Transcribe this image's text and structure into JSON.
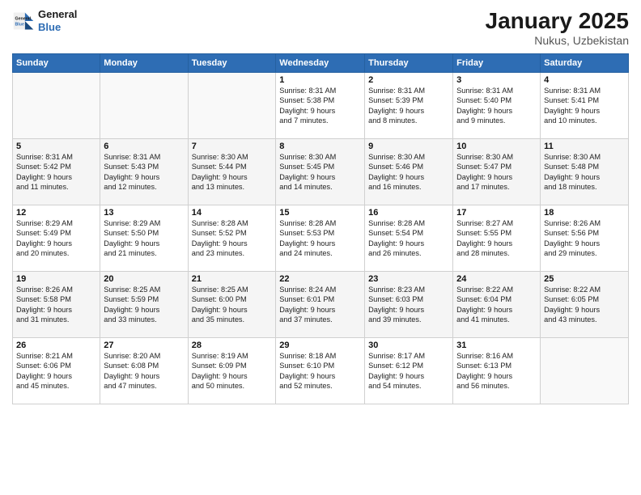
{
  "logo": {
    "line1": "General",
    "line2": "Blue"
  },
  "title": "January 2025",
  "subtitle": "Nukus, Uzbekistan",
  "weekdays": [
    "Sunday",
    "Monday",
    "Tuesday",
    "Wednesday",
    "Thursday",
    "Friday",
    "Saturday"
  ],
  "weeks": [
    [
      {
        "day": "",
        "info": ""
      },
      {
        "day": "",
        "info": ""
      },
      {
        "day": "",
        "info": ""
      },
      {
        "day": "1",
        "info": "Sunrise: 8:31 AM\nSunset: 5:38 PM\nDaylight: 9 hours\nand 7 minutes."
      },
      {
        "day": "2",
        "info": "Sunrise: 8:31 AM\nSunset: 5:39 PM\nDaylight: 9 hours\nand 8 minutes."
      },
      {
        "day": "3",
        "info": "Sunrise: 8:31 AM\nSunset: 5:40 PM\nDaylight: 9 hours\nand 9 minutes."
      },
      {
        "day": "4",
        "info": "Sunrise: 8:31 AM\nSunset: 5:41 PM\nDaylight: 9 hours\nand 10 minutes."
      }
    ],
    [
      {
        "day": "5",
        "info": "Sunrise: 8:31 AM\nSunset: 5:42 PM\nDaylight: 9 hours\nand 11 minutes."
      },
      {
        "day": "6",
        "info": "Sunrise: 8:31 AM\nSunset: 5:43 PM\nDaylight: 9 hours\nand 12 minutes."
      },
      {
        "day": "7",
        "info": "Sunrise: 8:30 AM\nSunset: 5:44 PM\nDaylight: 9 hours\nand 13 minutes."
      },
      {
        "day": "8",
        "info": "Sunrise: 8:30 AM\nSunset: 5:45 PM\nDaylight: 9 hours\nand 14 minutes."
      },
      {
        "day": "9",
        "info": "Sunrise: 8:30 AM\nSunset: 5:46 PM\nDaylight: 9 hours\nand 16 minutes."
      },
      {
        "day": "10",
        "info": "Sunrise: 8:30 AM\nSunset: 5:47 PM\nDaylight: 9 hours\nand 17 minutes."
      },
      {
        "day": "11",
        "info": "Sunrise: 8:30 AM\nSunset: 5:48 PM\nDaylight: 9 hours\nand 18 minutes."
      }
    ],
    [
      {
        "day": "12",
        "info": "Sunrise: 8:29 AM\nSunset: 5:49 PM\nDaylight: 9 hours\nand 20 minutes."
      },
      {
        "day": "13",
        "info": "Sunrise: 8:29 AM\nSunset: 5:50 PM\nDaylight: 9 hours\nand 21 minutes."
      },
      {
        "day": "14",
        "info": "Sunrise: 8:28 AM\nSunset: 5:52 PM\nDaylight: 9 hours\nand 23 minutes."
      },
      {
        "day": "15",
        "info": "Sunrise: 8:28 AM\nSunset: 5:53 PM\nDaylight: 9 hours\nand 24 minutes."
      },
      {
        "day": "16",
        "info": "Sunrise: 8:28 AM\nSunset: 5:54 PM\nDaylight: 9 hours\nand 26 minutes."
      },
      {
        "day": "17",
        "info": "Sunrise: 8:27 AM\nSunset: 5:55 PM\nDaylight: 9 hours\nand 28 minutes."
      },
      {
        "day": "18",
        "info": "Sunrise: 8:26 AM\nSunset: 5:56 PM\nDaylight: 9 hours\nand 29 minutes."
      }
    ],
    [
      {
        "day": "19",
        "info": "Sunrise: 8:26 AM\nSunset: 5:58 PM\nDaylight: 9 hours\nand 31 minutes."
      },
      {
        "day": "20",
        "info": "Sunrise: 8:25 AM\nSunset: 5:59 PM\nDaylight: 9 hours\nand 33 minutes."
      },
      {
        "day": "21",
        "info": "Sunrise: 8:25 AM\nSunset: 6:00 PM\nDaylight: 9 hours\nand 35 minutes."
      },
      {
        "day": "22",
        "info": "Sunrise: 8:24 AM\nSunset: 6:01 PM\nDaylight: 9 hours\nand 37 minutes."
      },
      {
        "day": "23",
        "info": "Sunrise: 8:23 AM\nSunset: 6:03 PM\nDaylight: 9 hours\nand 39 minutes."
      },
      {
        "day": "24",
        "info": "Sunrise: 8:22 AM\nSunset: 6:04 PM\nDaylight: 9 hours\nand 41 minutes."
      },
      {
        "day": "25",
        "info": "Sunrise: 8:22 AM\nSunset: 6:05 PM\nDaylight: 9 hours\nand 43 minutes."
      }
    ],
    [
      {
        "day": "26",
        "info": "Sunrise: 8:21 AM\nSunset: 6:06 PM\nDaylight: 9 hours\nand 45 minutes."
      },
      {
        "day": "27",
        "info": "Sunrise: 8:20 AM\nSunset: 6:08 PM\nDaylight: 9 hours\nand 47 minutes."
      },
      {
        "day": "28",
        "info": "Sunrise: 8:19 AM\nSunset: 6:09 PM\nDaylight: 9 hours\nand 50 minutes."
      },
      {
        "day": "29",
        "info": "Sunrise: 8:18 AM\nSunset: 6:10 PM\nDaylight: 9 hours\nand 52 minutes."
      },
      {
        "day": "30",
        "info": "Sunrise: 8:17 AM\nSunset: 6:12 PM\nDaylight: 9 hours\nand 54 minutes."
      },
      {
        "day": "31",
        "info": "Sunrise: 8:16 AM\nSunset: 6:13 PM\nDaylight: 9 hours\nand 56 minutes."
      },
      {
        "day": "",
        "info": ""
      }
    ]
  ]
}
